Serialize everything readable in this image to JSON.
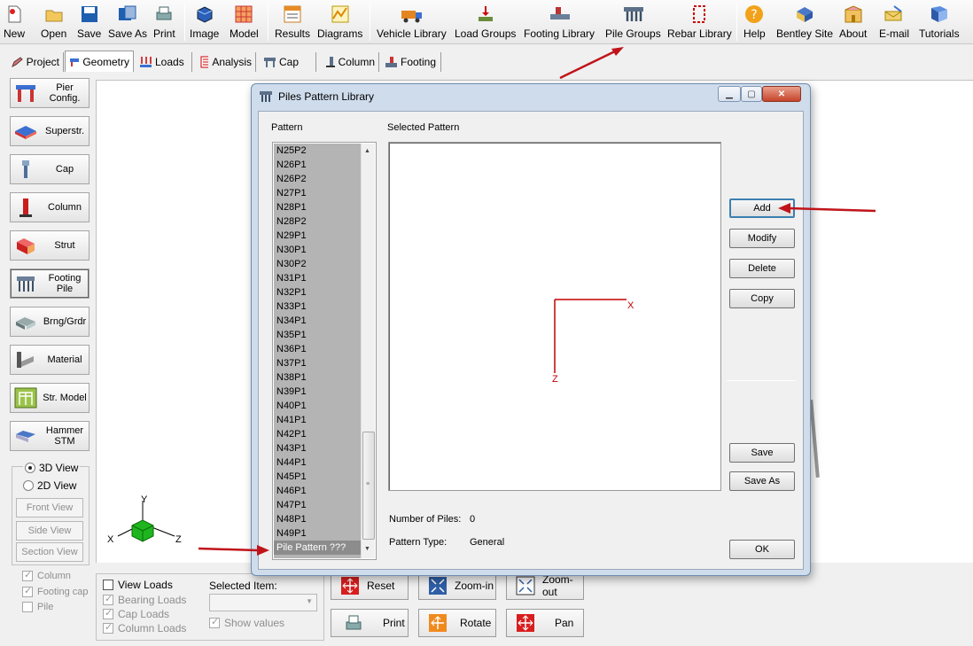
{
  "toolbar": {
    "items": [
      {
        "label": "New",
        "icon": "new-icon"
      },
      {
        "label": "Open",
        "icon": "open-folder-icon"
      },
      {
        "label": "Save",
        "icon": "save-disk-icon"
      },
      {
        "label": "Save As",
        "icon": "save-as-icon"
      },
      {
        "label": "Print",
        "icon": "print-icon"
      },
      {
        "label": "Image",
        "icon": "image-cube-icon"
      },
      {
        "label": "Model",
        "icon": "model-grid-icon"
      },
      {
        "label": "Results",
        "icon": "results-table-icon"
      },
      {
        "label": "Diagrams",
        "icon": "diagrams-icon"
      },
      {
        "label": "Vehicle Library",
        "icon": "truck-icon"
      },
      {
        "label": "Load Groups",
        "icon": "load-groups-icon"
      },
      {
        "label": "Footing Library",
        "icon": "footing-library-icon"
      },
      {
        "label": "Pile Groups",
        "icon": "pile-groups-icon"
      },
      {
        "label": "Rebar Library",
        "icon": "rebar-icon"
      },
      {
        "label": "Help",
        "icon": "help-icon"
      },
      {
        "label": "Bentley Site",
        "icon": "bentley-icon"
      },
      {
        "label": "About",
        "icon": "about-icon"
      },
      {
        "label": "E-mail",
        "icon": "email-icon"
      },
      {
        "label": "Tutorials",
        "icon": "tutorials-book-icon"
      }
    ]
  },
  "tabs": [
    {
      "label": "Project"
    },
    {
      "label": "Geometry",
      "active": true
    },
    {
      "label": "Loads"
    },
    {
      "label": "Analysis"
    },
    {
      "label": "Cap"
    },
    {
      "label": "Column"
    },
    {
      "label": "Footing"
    }
  ],
  "left_buttons": [
    {
      "label": "Pier\nConfig."
    },
    {
      "label": "Superstr."
    },
    {
      "label": "Cap"
    },
    {
      "label": "Column"
    },
    {
      "label": "Strut"
    },
    {
      "label": "Footing\nPile"
    },
    {
      "label": "Brng/Grdr"
    },
    {
      "label": "Material"
    },
    {
      "label": "Str. Model"
    },
    {
      "label": "Hammer\nSTM"
    }
  ],
  "view": {
    "view_3d": "3D View",
    "view_2d": "2D View",
    "front": "Front View",
    "side": "Side View",
    "section": "Section View",
    "chk_column": "Column",
    "chk_footing_cap": "Footing cap",
    "chk_pile": "Pile"
  },
  "axes": {
    "y": "Y",
    "x": "X",
    "z": "Z"
  },
  "bottom": {
    "view_loads": "View Loads",
    "bearing_loads": "Bearing Loads",
    "cap_loads": "Cap Loads",
    "column_loads": "Column Loads",
    "selected_item": "Selected Item:",
    "show_values": "Show values",
    "reset": "Reset",
    "zoom_in": "Zoom-in",
    "zoom_out": "Zoom-out",
    "print": "Print",
    "rotate": "Rotate",
    "pan": "Pan"
  },
  "dialog": {
    "title": "Piles Pattern Library",
    "pattern_label": "Pattern",
    "selected_label": "Selected Pattern",
    "patterns": [
      "N25P2",
      "N26P1",
      "N26P2",
      "N27P1",
      "N28P1",
      "N28P2",
      "N29P1",
      "N30P1",
      "N30P2",
      "N31P1",
      "N32P1",
      "N33P1",
      "N34P1",
      "N35P1",
      "N36P1",
      "N37P1",
      "N38P1",
      "N39P1",
      "N40P1",
      "N41P1",
      "N42P1",
      "N43P1",
      "N44P1",
      "N45P1",
      "N46P1",
      "N47P1",
      "N48P1",
      "N49P1",
      "Pile Pattern ???"
    ],
    "selected_index": 28,
    "axis_x": "X",
    "axis_z": "Z",
    "buttons": {
      "add": "Add",
      "modify": "Modify",
      "delete": "Delete",
      "copy": "Copy",
      "save": "Save",
      "save_as": "Save As",
      "ok": "OK"
    },
    "num_piles_label": "Number of Piles:",
    "num_piles_value": "0",
    "pattern_type_label": "Pattern Type:",
    "pattern_type_value": "General"
  },
  "colors": {
    "annotation_arrow": "#c0141a",
    "axis_red": "#c00000",
    "selection_gray": "#8c8c8c",
    "list_bg": "#b4b4b4"
  }
}
